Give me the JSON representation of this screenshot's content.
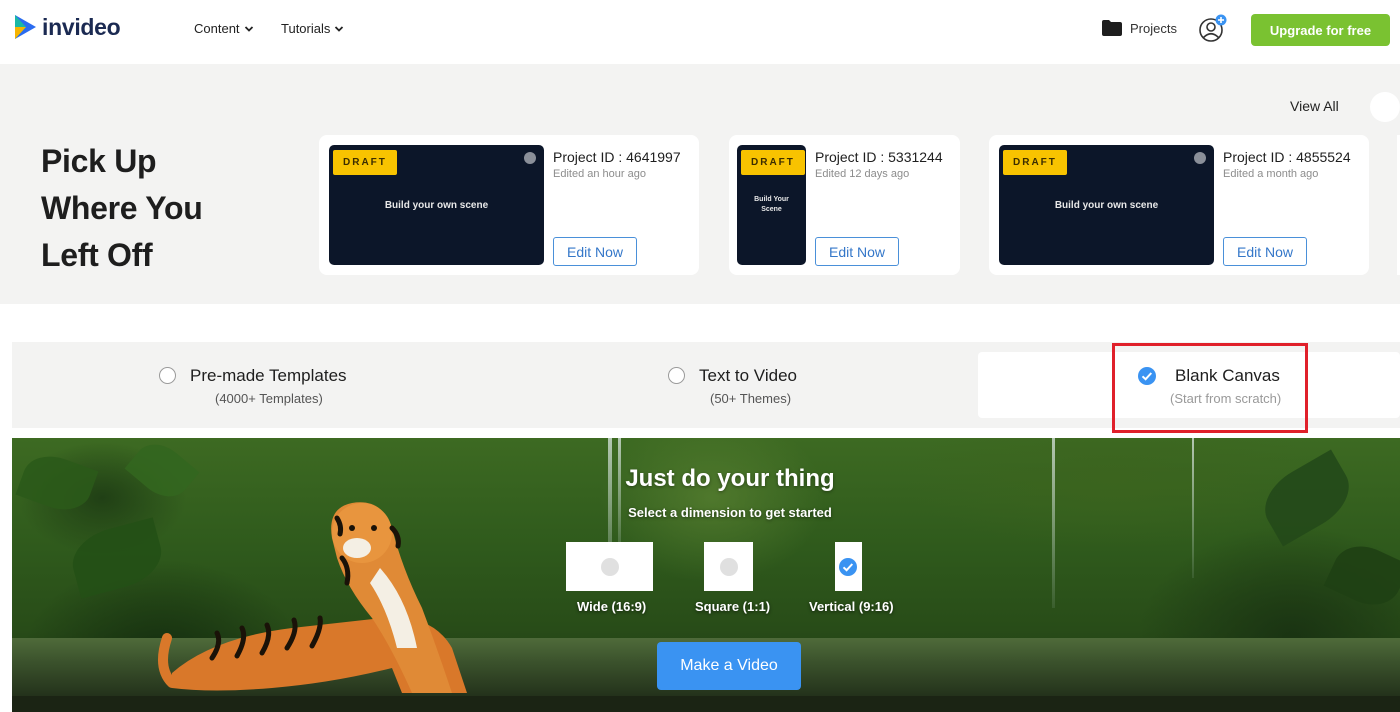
{
  "header": {
    "logo_text": "invideo",
    "nav": [
      {
        "label": "Content"
      },
      {
        "label": "Tutorials"
      }
    ],
    "projects_label": "Projects",
    "upgrade_label": "Upgrade for free"
  },
  "recent": {
    "heading": [
      "Pick Up",
      "Where You",
      "Left Off"
    ],
    "view_all": "View All",
    "draft_label": "DRAFT",
    "edit_label": "Edit Now",
    "projects": [
      {
        "id": "Project ID : 4641997",
        "edited": "Edited an hour ago",
        "thumb_text": "Build your own scene"
      },
      {
        "id": "Project ID : 5331244",
        "edited": "Edited 12 days ago",
        "thumb_text": "Build Your Scene"
      },
      {
        "id": "Project ID : 4855524",
        "edited": "Edited a month ago",
        "thumb_text": "Build your own scene"
      }
    ]
  },
  "options": [
    {
      "title": "Pre-made Templates",
      "subtitle": "(4000+ Templates)",
      "selected": false
    },
    {
      "title": "Text to Video",
      "subtitle": "(50+ Themes)",
      "selected": false
    },
    {
      "title": "Blank Canvas",
      "subtitle": "(Start from scratch)",
      "selected": true
    }
  ],
  "hero": {
    "title": "Just do your thing",
    "subtitle": "Select a dimension to get started",
    "dimensions": [
      {
        "label": "Wide (16:9)",
        "selected": false
      },
      {
        "label": "Square (1:1)",
        "selected": false
      },
      {
        "label": "Vertical (9:16)",
        "selected": true
      }
    ],
    "cta_label": "Make a Video"
  },
  "colors": {
    "accent_blue": "#3a93f2",
    "upgrade_green": "#7ac231",
    "draft_yellow": "#f8c300",
    "highlight_red": "#e0202a"
  }
}
